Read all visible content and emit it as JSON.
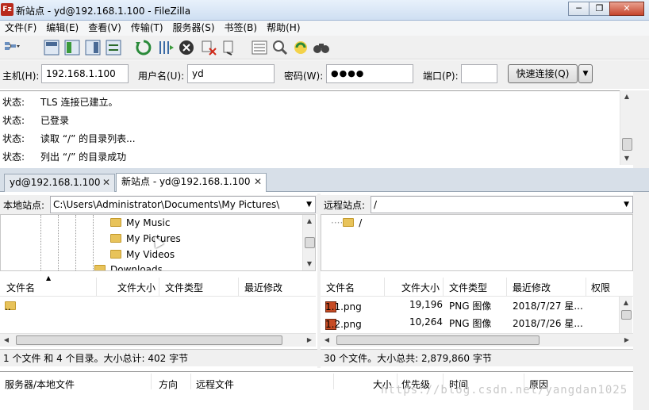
{
  "window": {
    "title": "新站点 - yd@192.168.1.100 - FileZilla",
    "app_icon": "Fz",
    "minimize": "─",
    "maximize": "❐",
    "close": "✕"
  },
  "menu": [
    "文件(F)",
    "编辑(E)",
    "查看(V)",
    "传输(T)",
    "服务器(S)",
    "书签(B)",
    "帮助(H)"
  ],
  "toolbar_icons": [
    "site-manager-icon",
    "toggle-log-icon",
    "toggle-local-tree-icon",
    "toggle-remote-tree-icon",
    "toggle-queue-icon",
    "refresh-icon",
    "process-queue-icon",
    "cancel-icon",
    "disconnect-icon",
    "reconnect-icon",
    "filter-icon",
    "compare-icon",
    "sync-browse-icon",
    "search-icon"
  ],
  "quickconnect": {
    "host_label": "主机(H):",
    "host_value": "192.168.1.100",
    "user_label": "用户名(U):",
    "user_value": "yd",
    "pass_label": "密码(W):",
    "pass_value": "●●●●",
    "port_label": "端口(P):",
    "port_value": "",
    "button": "快速连接(Q)",
    "dropdown": "▼"
  },
  "log": [
    {
      "kind": "状态:",
      "text": "TLS 连接已建立。"
    },
    {
      "kind": "状态:",
      "text": "已登录"
    },
    {
      "kind": "状态:",
      "text": "读取 “/” 的目录列表..."
    },
    {
      "kind": "状态:",
      "text": "列出 “/” 的目录成功"
    }
  ],
  "tabs": [
    {
      "label": "yd@192.168.1.100",
      "close": "✕"
    },
    {
      "label": "新站点 - yd@192.168.1.100",
      "close": "✕"
    }
  ],
  "local": {
    "site_label": "本地站点:",
    "path": "C:\\Users\\Administrator\\Documents\\My Pictures\\",
    "tree": [
      "My Music",
      "My Pictures",
      "My Videos",
      "Downloads"
    ],
    "columns": [
      "文件名",
      "文件大小",
      "文件类型",
      "最近修改"
    ],
    "files": [
      {
        "name": ".."
      }
    ],
    "status": "1 个文件 和 4 个目录。大小总计: 402 字节"
  },
  "remote": {
    "site_label": "远程站点:",
    "path": "/",
    "tree": [
      "/"
    ],
    "columns": [
      "文件名",
      "文件大小",
      "文件类型",
      "最近修改",
      "权限"
    ],
    "files": [
      {
        "name": "1.1.png",
        "size": "19,196",
        "type": "PNG 图像",
        "modified": "2018/7/27 星..."
      },
      {
        "name": "1.2.png",
        "size": "10,264",
        "type": "PNG 图像",
        "modified": "2018/7/26 星..."
      }
    ],
    "status": "30 个文件。大小总共: 2,879,860 字节"
  },
  "queue": {
    "columns": [
      "服务器/本地文件",
      "方向",
      "远程文件",
      "大小",
      "优先级",
      "时间",
      "原因"
    ]
  },
  "watermark": "https://blog.csdn.net/yangdan1025",
  "colors": {
    "title_bg": "#dbe7f5",
    "close": "#c6452d",
    "folder": "#e8c35a"
  }
}
